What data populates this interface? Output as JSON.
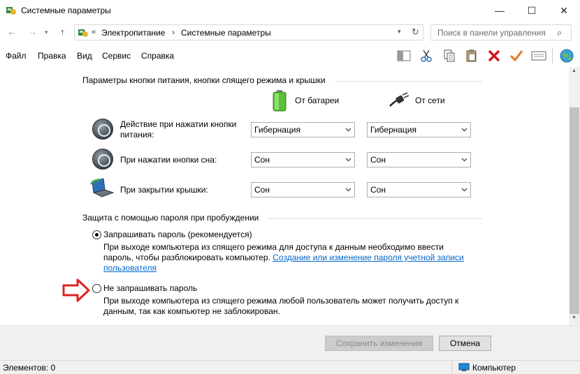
{
  "window": {
    "title": "Системные параметры",
    "minimize_glyph": "—",
    "maximize_glyph": "☐",
    "close_glyph": "✕"
  },
  "address": {
    "overflow": "«",
    "crumbs": [
      "Электропитание",
      "Системные параметры"
    ],
    "separator": "›",
    "search_placeholder": "Поиск в панели управления"
  },
  "menu": [
    "Файл",
    "Правка",
    "Вид",
    "Сервис",
    "Справка"
  ],
  "toolbar_icons": [
    "view-pane-icon",
    "cut-icon",
    "copy-icon",
    "paste-icon",
    "delete-icon",
    "check-icon",
    "properties-icon",
    "globe-icon"
  ],
  "power_section": {
    "heading": "Параметры кнопки питания, кнопки спящего режима и крышки",
    "battery_label": "От батареи",
    "ac_label": "От сети",
    "rows": [
      {
        "label": "Действие при нажатии кнопки питания:",
        "battery": "Гибернация",
        "ac": "Гибернация"
      },
      {
        "label": "При нажатии кнопки сна:",
        "battery": "Сон",
        "ac": "Сон"
      },
      {
        "label": "При закрытии крышки:",
        "battery": "Сон",
        "ac": "Сон"
      }
    ]
  },
  "password_section": {
    "heading": "Защита с помощью пароля при пробуждении",
    "option1": {
      "label": "Запрашивать пароль (рекомендуется)",
      "desc": "При выходе компьютера из спящего режима для доступа к данным необходимо ввести пароль, чтобы разблокировать компьютер.",
      "link": "Создание или изменение пароля учетной записи пользователя",
      "checked": true
    },
    "option2": {
      "label": "Не запрашивать пароль",
      "desc": "При выходе компьютера из спящего режима любой пользователь может получить доступ к данным, так как компьютер не заблокирован.",
      "checked": false
    }
  },
  "buttons": {
    "save": "Сохранить изменения",
    "cancel": "Отмена"
  },
  "status": {
    "items": "Элементов: 0",
    "location": "Компьютер"
  }
}
